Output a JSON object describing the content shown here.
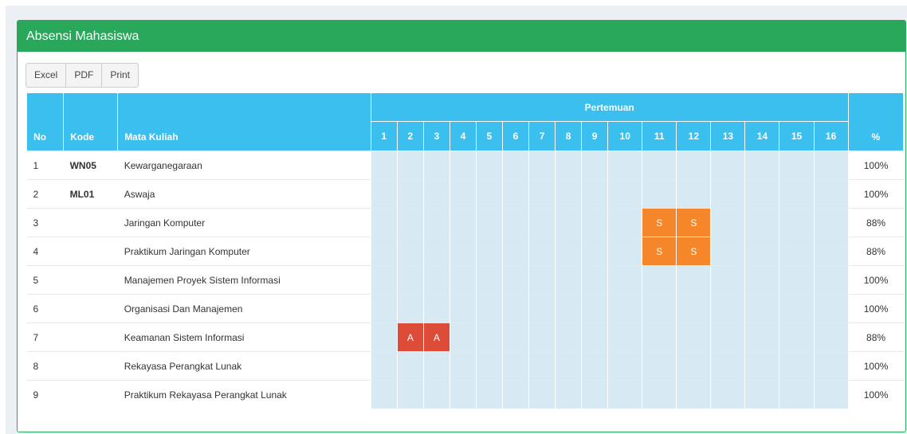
{
  "header": {
    "title": "Absensi Mahasiswa"
  },
  "buttons": {
    "excel": "Excel",
    "pdf": "PDF",
    "print": "Print"
  },
  "table": {
    "col_no": "No",
    "col_kode": "Kode",
    "col_mk": "Mata Kuliah",
    "col_pertemuan": "Pertemuan",
    "col_pct": "%",
    "meetings": [
      "1",
      "2",
      "3",
      "4",
      "5",
      "6",
      "7",
      "8",
      "9",
      "10",
      "11",
      "12",
      "13",
      "14",
      "15",
      "16"
    ],
    "rows": [
      {
        "no": "1",
        "kode": "WN05",
        "mk": "Kewarganegaraan",
        "pct": "100%",
        "marks": [
          "",
          "",
          "",
          "",
          "",
          "",
          "",
          "",
          "",
          "",
          "",
          "",
          "",
          "",
          "",
          ""
        ]
      },
      {
        "no": "2",
        "kode": "ML01",
        "mk": "Aswaja",
        "pct": "100%",
        "marks": [
          "",
          "",
          "",
          "",
          "",
          "",
          "",
          "",
          "",
          "",
          "",
          "",
          "",
          "",
          "",
          ""
        ]
      },
      {
        "no": "3",
        "kode": "",
        "mk": "Jaringan Komputer",
        "pct": "88%",
        "marks": [
          "",
          "",
          "",
          "",
          "",
          "",
          "",
          "",
          "",
          "",
          "S",
          "S",
          "",
          "",
          "",
          ""
        ]
      },
      {
        "no": "4",
        "kode": "",
        "mk": "Praktikum Jaringan Komputer",
        "pct": "88%",
        "marks": [
          "",
          "",
          "",
          "",
          "",
          "",
          "",
          "",
          "",
          "",
          "S",
          "S",
          "",
          "",
          "",
          ""
        ]
      },
      {
        "no": "5",
        "kode": "",
        "mk": "Manajemen Proyek Sistem Informasi",
        "pct": "100%",
        "marks": [
          "",
          "",
          "",
          "",
          "",
          "",
          "",
          "",
          "",
          "",
          "",
          "",
          "",
          "",
          "",
          ""
        ]
      },
      {
        "no": "6",
        "kode": "",
        "mk": "Organisasi Dan Manajemen",
        "pct": "100%",
        "marks": [
          "",
          "",
          "",
          "",
          "",
          "",
          "",
          "",
          "",
          "",
          "",
          "",
          "",
          "",
          "",
          ""
        ]
      },
      {
        "no": "7",
        "kode": "",
        "mk": "Keamanan Sistem Informasi",
        "pct": "88%",
        "marks": [
          "",
          "A",
          "A",
          "",
          "",
          "",
          "",
          "",
          "",
          "",
          "",
          "",
          "",
          "",
          "",
          ""
        ]
      },
      {
        "no": "8",
        "kode": "",
        "mk": "Rekayasa Perangkat Lunak",
        "pct": "100%",
        "marks": [
          "",
          "",
          "",
          "",
          "",
          "",
          "",
          "",
          "",
          "",
          "",
          "",
          "",
          "",
          "",
          ""
        ]
      },
      {
        "no": "9",
        "kode": "",
        "mk": "Praktikum Rekayasa Perangkat Lunak",
        "pct": "100%",
        "marks": [
          "",
          "",
          "",
          "",
          "",
          "",
          "",
          "",
          "",
          "",
          "",
          "",
          "",
          "",
          "",
          ""
        ]
      }
    ]
  },
  "colors": {
    "header_green": "#29a85b",
    "table_header_blue": "#3bbfee",
    "sakit_orange": "#f5872a",
    "alpha_red": "#dd4b39",
    "empty_cell": "#d7e9f3"
  }
}
